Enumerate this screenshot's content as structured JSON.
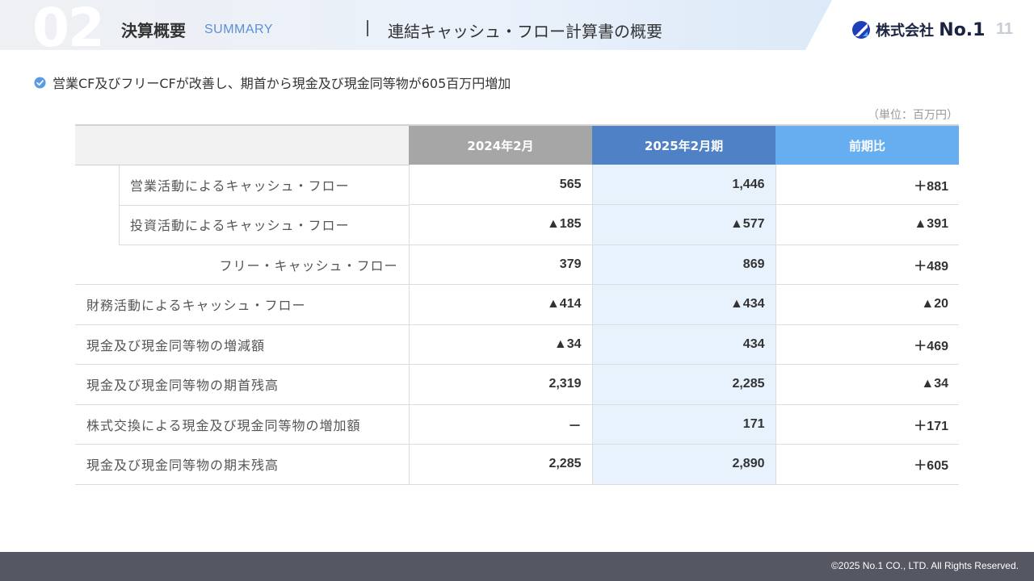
{
  "header": {
    "section_number": "02",
    "section_title": "決算概要",
    "section_subtitle": "SUMMARY",
    "page_heading": "連結キャッシュ・フロー計算書の概要",
    "page_number": "11"
  },
  "logo": {
    "company_name": "株式会社",
    "brand": "No.1",
    "accent_color": "#2a5bd7"
  },
  "lead": {
    "icon": "check-circle-icon",
    "text": "営業CF及びフリーCFが改善し、期首から現金及び現金同等物が605百万円増加"
  },
  "unit_note": "（単位：百万円）",
  "table": {
    "columns": [
      "",
      "2024年2月",
      "2025年2月期",
      "前期比"
    ],
    "header_colors": [
      "#f2f2f2",
      "#a6a6a6",
      "#4f81c7",
      "#66aef0"
    ],
    "rows": [
      {
        "label": "営業活動によるキャッシュ・フロー",
        "prev": "565",
        "curr": "1,446",
        "diff": "＋881"
      },
      {
        "label": "投資活動によるキャッシュ・フロー",
        "prev": "▲185",
        "curr": "▲577",
        "diff": "▲391"
      },
      {
        "label": "フリー・キャッシュ・フロー",
        "prev": "379",
        "curr": "869",
        "diff": "＋489"
      },
      {
        "label": "財務活動によるキャッシュ・フロー",
        "prev": "▲414",
        "curr": "▲434",
        "diff": "▲20"
      },
      {
        "label": "現金及び現金同等物の増減額",
        "prev": "▲34",
        "curr": "434",
        "diff": "＋469"
      },
      {
        "label": "現金及び現金同等物の期首残高",
        "prev": "2,319",
        "curr": "2,285",
        "diff": "▲34"
      },
      {
        "label": "株式交換による現金及び現金同等物の増加額",
        "prev": "－",
        "curr": "171",
        "diff": "＋171"
      },
      {
        "label": "現金及び現金同等物の期末残高",
        "prev": "2,285",
        "curr": "2,890",
        "diff": "＋605"
      }
    ]
  },
  "footer": {
    "copyright": "©2025 No.1 CO., LTD. All Rights Reserved."
  }
}
